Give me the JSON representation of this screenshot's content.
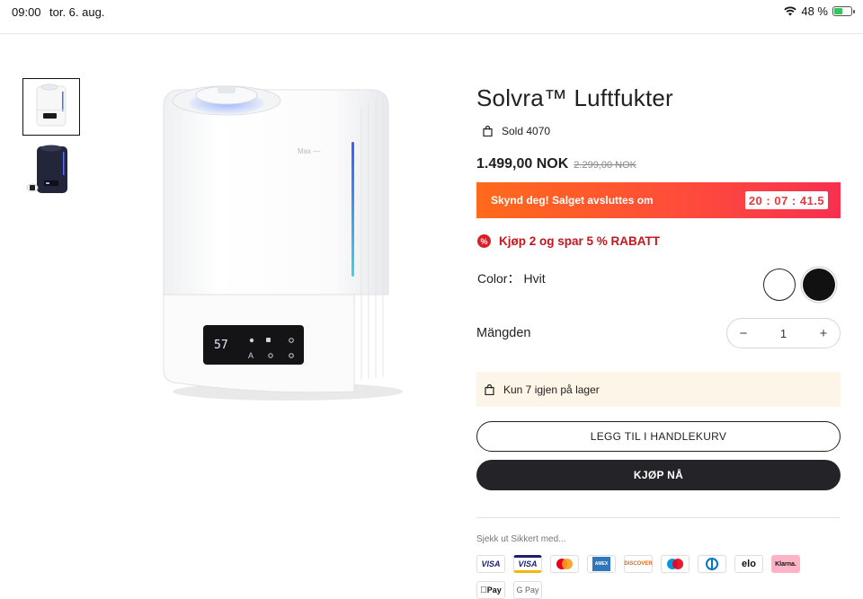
{
  "status_bar": {
    "time": "09:00",
    "date": "tor. 6. aug.",
    "battery": "48 %",
    "battery_level": 0.48
  },
  "gallery": {
    "thumbnails": [
      {
        "name": "white-humidifier",
        "selected": true
      },
      {
        "name": "black-humidifier",
        "selected": false
      }
    ],
    "device_display": {
      "reading": "57",
      "brand_mark": "Max"
    }
  },
  "product": {
    "title": "Solvra™ Luftfukter",
    "sold": "Sold 4070",
    "price": "1.499,00 NOK",
    "compare_price": "2.299,00 NOK",
    "promo": {
      "message": "Skynd deg! Salget avsluttes om",
      "countdown": "20 : 07 : 41.5",
      "gradient": [
        "#ff6a1a",
        "#f7304f"
      ]
    },
    "discount": {
      "badge": "%",
      "text": "Kjøp 2 og spar 5 % RABATT",
      "color": "#c4161c"
    },
    "color": {
      "label": "Color：",
      "value": "Hvit",
      "options": [
        {
          "name": "Hvit",
          "hex": "#ffffff",
          "selected": true
        },
        {
          "name": "Svart",
          "hex": "#111111",
          "selected": false
        }
      ]
    },
    "quantity": {
      "label": "Mängden",
      "minus": "−",
      "value": "1",
      "plus": "+"
    },
    "stock": "Kun 7 igjen på lager",
    "add_to_cart": "LEGG TIL I HANDLEKURV",
    "buy_now": "KJØP NÅ",
    "checkout_label": "Sjekk ut Sikkert med..."
  },
  "payment_methods": [
    {
      "name": "VISA",
      "label": "VISA"
    },
    {
      "name": "VISA Electron",
      "label": "VISA"
    },
    {
      "name": "Mastercard",
      "label": ""
    },
    {
      "name": "American Express",
      "label": ""
    },
    {
      "name": "Discover",
      "label": "DISCOVER"
    },
    {
      "name": "Maestro",
      "label": ""
    },
    {
      "name": "Diners Club",
      "label": ""
    },
    {
      "name": "Elo",
      "label": "elo"
    },
    {
      "name": "Klarna",
      "label": "Klarna."
    },
    {
      "name": "Apple Pay",
      "label": "Pay"
    },
    {
      "name": "Google Pay",
      "label": "G Pay"
    }
  ]
}
